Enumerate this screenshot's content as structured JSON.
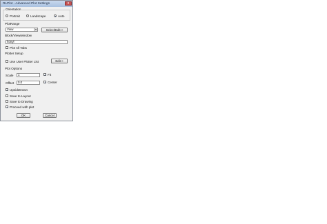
{
  "window": {
    "title": "RLPlot - Advanced Plot Settings",
    "close_glyph": "x"
  },
  "orientation": {
    "group_label": "Orientation",
    "options": [
      "Portrait",
      "Landscape",
      "Auto"
    ],
    "selected": "Auto"
  },
  "plot_range": {
    "group_label": "PlotRange",
    "selected_value": "View",
    "select_edit_label": "Select/Edit >",
    "block_label": "Block/View/window",
    "block_value": "honyl",
    "plot_all_tabs_label": "Plot All Tabs",
    "plot_all_tabs_checked": false
  },
  "plotter_setup": {
    "group_label": "Plotter Setup",
    "use_user_plotter_label": "Use User Plotter List",
    "use_user_plotter_checked": false,
    "edit_label": "Edit >"
  },
  "plot_options": {
    "group_label": "Plot Options",
    "scale_label": "Scale",
    "scale_value": "1",
    "fit_label": "Fit",
    "fit_checked": true,
    "offset_label": "Offset",
    "offset_value": "0.0",
    "center_label": "Center",
    "center_checked": true,
    "checkboxes": [
      {
        "label": "UpsideDown",
        "checked": true
      },
      {
        "label": "Save to Layout",
        "checked": false
      },
      {
        "label": "Save to Drawing",
        "checked": false
      },
      {
        "label": "Proceed with plot",
        "checked": true
      }
    ]
  },
  "footer": {
    "ok_label": "OK",
    "cancel_label": "Cancel"
  }
}
